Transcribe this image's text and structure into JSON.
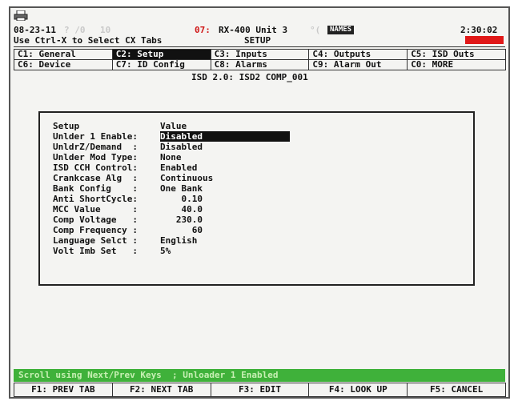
{
  "header": {
    "date": "08-23-11",
    "faint_a": "? /0",
    "faint_b": "10",
    "alarm_num": "07:",
    "unit": "RX-400 Unit 3",
    "temp": "°(",
    "time": "2:30:02",
    "hint": "Use Ctrl-X to Select CX Tabs",
    "mode": "SETUP",
    "names_badge": "NAMES"
  },
  "tabs_row1": [
    {
      "label": "C1: General"
    },
    {
      "label": "C2: Setup"
    },
    {
      "label": "C3: Inputs"
    },
    {
      "label": "C4: Outputs"
    },
    {
      "label": "C5: ISD Outs"
    }
  ],
  "tabs_row2": [
    {
      "label": "C6: Device"
    },
    {
      "label": "C7: ID Config"
    },
    {
      "label": "C8: Alarms"
    },
    {
      "label": "C9: Alarm Out"
    },
    {
      "label": "C0: MORE"
    }
  ],
  "subtitle": "ISD 2.0: ISD2 COMP_001",
  "setup": {
    "col_setup": "Setup",
    "col_value": "Value",
    "rows": [
      {
        "label": "Unlder 1 Enable:",
        "value": "Disabled"
      },
      {
        "label": "UnldrZ/Demand  :",
        "value": "Disabled"
      },
      {
        "label": "Unlder Mod Type:",
        "value": "None"
      },
      {
        "label": "ISD CCH Control:",
        "value": "Enabled"
      },
      {
        "label": "Crankcase Alg  :",
        "value": "Continuous"
      },
      {
        "label": "Bank Config    :",
        "value": "One Bank"
      },
      {
        "label": "Anti ShortCycle:",
        "value": "    0.10"
      },
      {
        "label": "MCC Value      :",
        "value": "    40.0"
      },
      {
        "label": "Comp Voltage   :",
        "value": "   230.0"
      },
      {
        "label": "Comp Frequency :",
        "value": "      60"
      },
      {
        "label": "Language Selct :",
        "value": "English"
      },
      {
        "label": "Volt Imb Set   :",
        "value": "5%"
      }
    ]
  },
  "status_bar": "Scroll using Next/Prev Keys  ; Unloader 1 Enabled",
  "fkeys": [
    {
      "label": "F1: PREV TAB"
    },
    {
      "label": "F2: NEXT TAB"
    },
    {
      "label": "F3: EDIT"
    },
    {
      "label": "F4: LOOK UP"
    },
    {
      "label": "F5: CANCEL"
    }
  ],
  "colors": {
    "status_green": "#3fb13a",
    "alarm_red": "#e01818"
  }
}
